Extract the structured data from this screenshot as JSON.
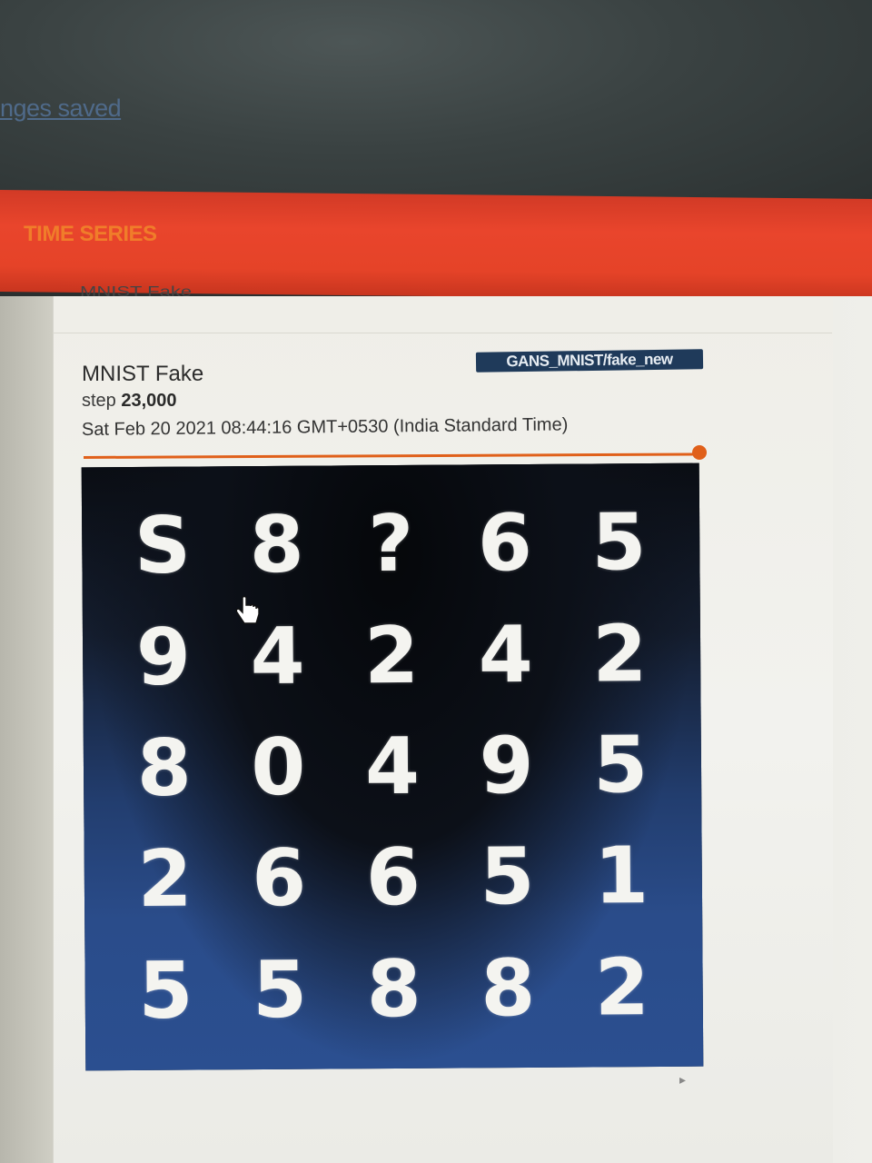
{
  "header": {
    "save_status": "nges saved"
  },
  "tabs": [
    {
      "label": "TIME SERIES"
    }
  ],
  "card": {
    "header_cut": "MNIST Fake",
    "run_tag": "GANS_MNIST/fake_new",
    "title": "MNIST Fake",
    "step_label": "step",
    "step_value": "23,000",
    "timestamp": "Sat Feb 20 2021 08:44:16 GMT+0530 (India Standard Time)"
  },
  "image_grid": {
    "cells": [
      "S",
      "8",
      "?",
      "6",
      "5",
      "9",
      "4",
      "2",
      "4",
      "2",
      "8",
      "0",
      "4",
      "9",
      "5",
      "2",
      "6",
      "6",
      "5",
      "1",
      "5",
      "5",
      "8",
      "8",
      "2"
    ]
  },
  "icons": {
    "cursor": "hand-pointer-icon",
    "scroll": "triangle-right-icon"
  },
  "colors": {
    "appbar": "#e54328",
    "accent": "#e0601a",
    "chip": "#1f3a5a"
  }
}
